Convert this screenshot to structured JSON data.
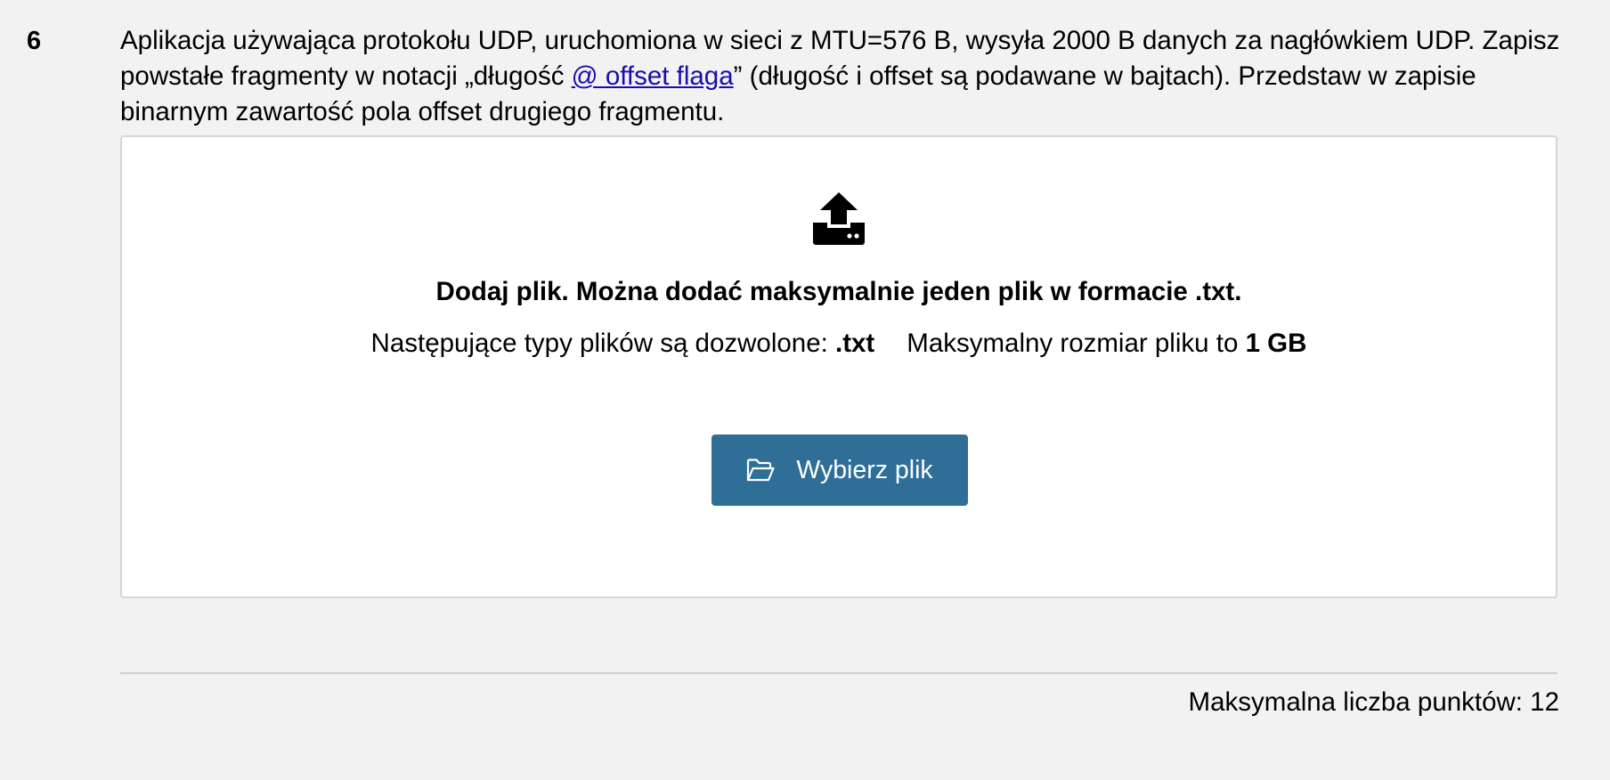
{
  "question": {
    "number": "6",
    "text_part1": "Aplikacja używająca protokołu UDP, uruchomiona w sieci z MTU=576 B, wysyła 2000 B danych za nagłówkiem UDP. Zapisz powstałe fragmenty w notacji „długość ",
    "link_text": "@ offset flaga",
    "text_part2": "” (długość i offset są podawane w bajtach). Przedstaw w zapisie binarnym zawartość pola offset drugiego fragmentu."
  },
  "upload": {
    "icon": "upload-icon",
    "title": "Dodaj plik. Można dodać maksymalnie jeden plik w formacie .txt.",
    "allowed_label": "Następujące typy plików są dozwolone: ",
    "allowed_value": ".txt",
    "max_size_label": "Maksymalny rozmiar pliku to ",
    "max_size_value": "1 GB",
    "button_icon": "folder-open-icon",
    "button_label": "Wybierz plik"
  },
  "footer": {
    "max_points": "Maksymalna liczba punktów: 12"
  },
  "colors": {
    "page_background": "#f2f2f2",
    "button_background": "#2e6e97",
    "link": "#1a0dab"
  }
}
